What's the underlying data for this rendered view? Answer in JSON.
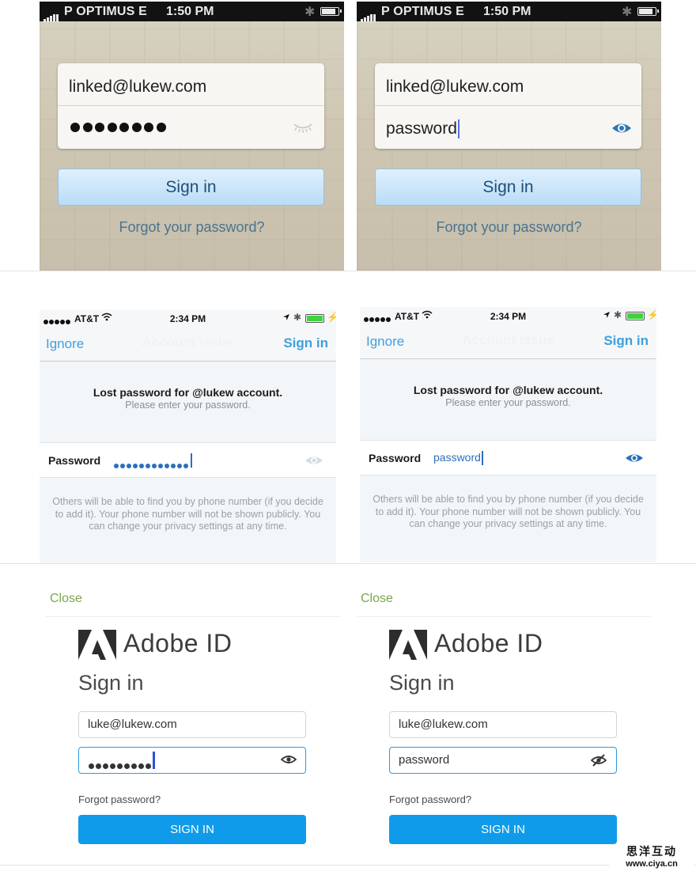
{
  "row1": {
    "status": {
      "carrier": "P OPTIMUS  E",
      "time": "1:50 PM"
    },
    "email": "linked@lukew.com",
    "password_masked_count": 8,
    "password_visible": "password",
    "sign_in": "Sign in",
    "forgot": "Forgot your password?"
  },
  "row2": {
    "status": {
      "carrier": "AT&T",
      "time": "2:34 PM"
    },
    "nav": {
      "ignore": "Ignore",
      "title": "Account issue",
      "sign_in": "Sign in"
    },
    "heading": "Lost password for @lukew account.",
    "subheading": "Please enter your password.",
    "password_label": "Password",
    "password_masked_count": 12,
    "password_visible": "password",
    "info": "Others will be able to find you by phone number (if you decide to add it). Your phone number will not be shown publicly. You can change your privacy settings at any time.",
    "accent_color": "#3f9fdc",
    "eye_color": "#2b6fbd"
  },
  "row3": {
    "close": "Close",
    "brand": "Adobe ID",
    "title": "Sign in",
    "email": "luke@lukew.com",
    "password_masked_count": 9,
    "password_visible": "password",
    "forgot": "Forgot password?",
    "button": "SIGN IN",
    "button_color": "#0f9be9",
    "close_color": "#7aa64a"
  },
  "watermark": {
    "line1": "思洋互动",
    "line2": "www.ciya.cn"
  }
}
